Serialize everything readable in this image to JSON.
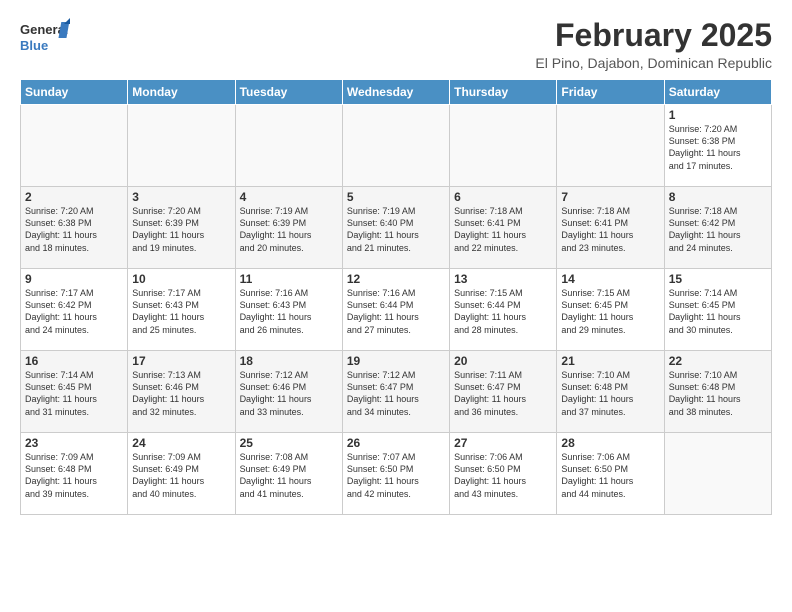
{
  "logo": {
    "line1": "General",
    "line2": "Blue"
  },
  "title": "February 2025",
  "subtitle": "El Pino, Dajabon, Dominican Republic",
  "weekdays": [
    "Sunday",
    "Monday",
    "Tuesday",
    "Wednesday",
    "Thursday",
    "Friday",
    "Saturday"
  ],
  "weeks": [
    [
      {
        "day": "",
        "info": ""
      },
      {
        "day": "",
        "info": ""
      },
      {
        "day": "",
        "info": ""
      },
      {
        "day": "",
        "info": ""
      },
      {
        "day": "",
        "info": ""
      },
      {
        "day": "",
        "info": ""
      },
      {
        "day": "1",
        "info": "Sunrise: 7:20 AM\nSunset: 6:38 PM\nDaylight: 11 hours\nand 17 minutes."
      }
    ],
    [
      {
        "day": "2",
        "info": "Sunrise: 7:20 AM\nSunset: 6:38 PM\nDaylight: 11 hours\nand 18 minutes."
      },
      {
        "day": "3",
        "info": "Sunrise: 7:20 AM\nSunset: 6:39 PM\nDaylight: 11 hours\nand 19 minutes."
      },
      {
        "day": "4",
        "info": "Sunrise: 7:19 AM\nSunset: 6:39 PM\nDaylight: 11 hours\nand 20 minutes."
      },
      {
        "day": "5",
        "info": "Sunrise: 7:19 AM\nSunset: 6:40 PM\nDaylight: 11 hours\nand 21 minutes."
      },
      {
        "day": "6",
        "info": "Sunrise: 7:18 AM\nSunset: 6:41 PM\nDaylight: 11 hours\nand 22 minutes."
      },
      {
        "day": "7",
        "info": "Sunrise: 7:18 AM\nSunset: 6:41 PM\nDaylight: 11 hours\nand 23 minutes."
      },
      {
        "day": "8",
        "info": "Sunrise: 7:18 AM\nSunset: 6:42 PM\nDaylight: 11 hours\nand 24 minutes."
      }
    ],
    [
      {
        "day": "9",
        "info": "Sunrise: 7:17 AM\nSunset: 6:42 PM\nDaylight: 11 hours\nand 24 minutes."
      },
      {
        "day": "10",
        "info": "Sunrise: 7:17 AM\nSunset: 6:43 PM\nDaylight: 11 hours\nand 25 minutes."
      },
      {
        "day": "11",
        "info": "Sunrise: 7:16 AM\nSunset: 6:43 PM\nDaylight: 11 hours\nand 26 minutes."
      },
      {
        "day": "12",
        "info": "Sunrise: 7:16 AM\nSunset: 6:44 PM\nDaylight: 11 hours\nand 27 minutes."
      },
      {
        "day": "13",
        "info": "Sunrise: 7:15 AM\nSunset: 6:44 PM\nDaylight: 11 hours\nand 28 minutes."
      },
      {
        "day": "14",
        "info": "Sunrise: 7:15 AM\nSunset: 6:45 PM\nDaylight: 11 hours\nand 29 minutes."
      },
      {
        "day": "15",
        "info": "Sunrise: 7:14 AM\nSunset: 6:45 PM\nDaylight: 11 hours\nand 30 minutes."
      }
    ],
    [
      {
        "day": "16",
        "info": "Sunrise: 7:14 AM\nSunset: 6:45 PM\nDaylight: 11 hours\nand 31 minutes."
      },
      {
        "day": "17",
        "info": "Sunrise: 7:13 AM\nSunset: 6:46 PM\nDaylight: 11 hours\nand 32 minutes."
      },
      {
        "day": "18",
        "info": "Sunrise: 7:12 AM\nSunset: 6:46 PM\nDaylight: 11 hours\nand 33 minutes."
      },
      {
        "day": "19",
        "info": "Sunrise: 7:12 AM\nSunset: 6:47 PM\nDaylight: 11 hours\nand 34 minutes."
      },
      {
        "day": "20",
        "info": "Sunrise: 7:11 AM\nSunset: 6:47 PM\nDaylight: 11 hours\nand 36 minutes."
      },
      {
        "day": "21",
        "info": "Sunrise: 7:10 AM\nSunset: 6:48 PM\nDaylight: 11 hours\nand 37 minutes."
      },
      {
        "day": "22",
        "info": "Sunrise: 7:10 AM\nSunset: 6:48 PM\nDaylight: 11 hours\nand 38 minutes."
      }
    ],
    [
      {
        "day": "23",
        "info": "Sunrise: 7:09 AM\nSunset: 6:48 PM\nDaylight: 11 hours\nand 39 minutes."
      },
      {
        "day": "24",
        "info": "Sunrise: 7:09 AM\nSunset: 6:49 PM\nDaylight: 11 hours\nand 40 minutes."
      },
      {
        "day": "25",
        "info": "Sunrise: 7:08 AM\nSunset: 6:49 PM\nDaylight: 11 hours\nand 41 minutes."
      },
      {
        "day": "26",
        "info": "Sunrise: 7:07 AM\nSunset: 6:50 PM\nDaylight: 11 hours\nand 42 minutes."
      },
      {
        "day": "27",
        "info": "Sunrise: 7:06 AM\nSunset: 6:50 PM\nDaylight: 11 hours\nand 43 minutes."
      },
      {
        "day": "28",
        "info": "Sunrise: 7:06 AM\nSunset: 6:50 PM\nDaylight: 11 hours\nand 44 minutes."
      },
      {
        "day": "",
        "info": ""
      }
    ]
  ]
}
